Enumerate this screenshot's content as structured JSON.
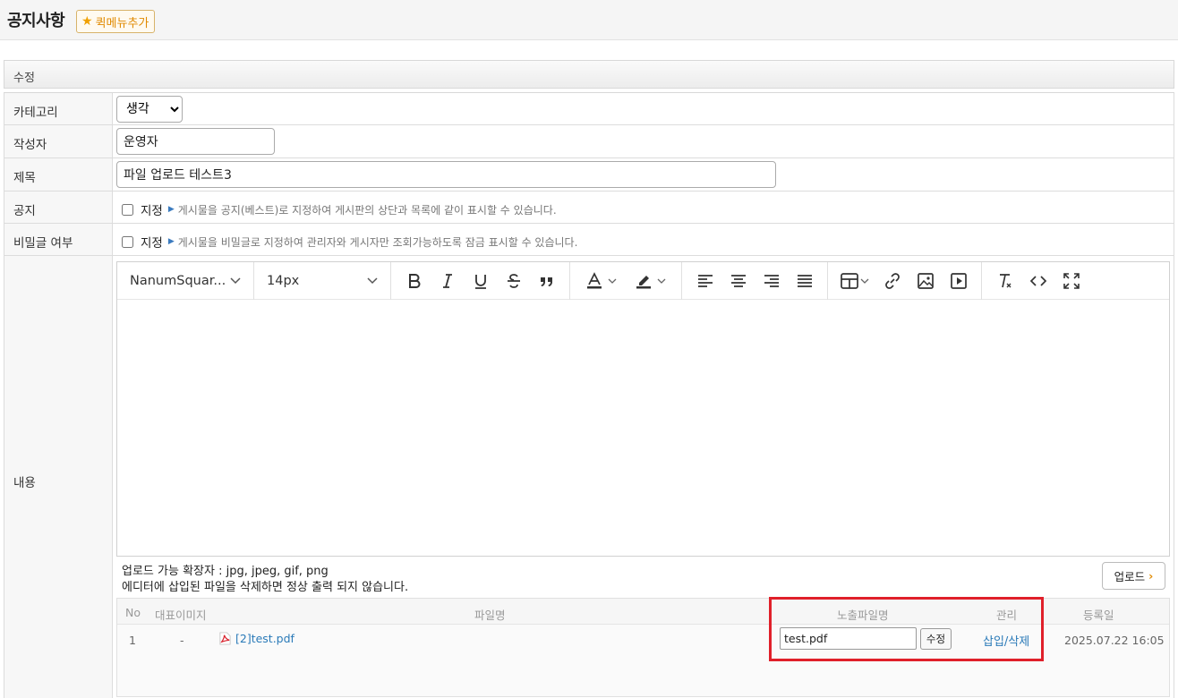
{
  "header": {
    "title": "공지사항",
    "quick_menu_label": "퀵메뉴추가"
  },
  "section": {
    "title": "수정"
  },
  "form": {
    "category": {
      "label": "카테고리",
      "selected": "생각"
    },
    "author": {
      "label": "작성자",
      "value": "운영자"
    },
    "subject": {
      "label": "제목",
      "value": "파일 업로드 테스트3"
    },
    "notice": {
      "label": "공지",
      "checkbox_label": "지정",
      "hint": "게시물을 공지(베스트)로 지정하여 게시판의 상단과 목록에 같이 표시할 수 있습니다."
    },
    "secret": {
      "label": "비밀글 여부",
      "checkbox_label": "지정",
      "hint": "게시물을 비밀글로 지정하여 관리자와 게시자만 조회가능하도록 잠금 표시할 수 있습니다."
    },
    "content": {
      "label": "내용"
    }
  },
  "editor": {
    "font_family": "NanumSquar...",
    "font_size": "14px",
    "tools": [
      "bold-icon",
      "italic-icon",
      "underline-icon",
      "strikethrough-icon",
      "quote-icon",
      "font-color-icon",
      "highlight-icon",
      "align-left-icon",
      "align-center-icon",
      "align-right-icon",
      "align-justify-icon",
      "table-icon",
      "link-icon",
      "image-icon",
      "video-icon",
      "clear-format-icon",
      "code-view-icon",
      "fullscreen-icon"
    ]
  },
  "upload": {
    "line1": "업로드 가능 확장자 : jpg, jpeg, gif, png",
    "line2": "에디터에 삽입된 파일을 삭제하면 정상 출력 되지 않습니다.",
    "button_label": "업로드"
  },
  "file_table": {
    "headers": {
      "no": "No",
      "thumb": "대표이미지",
      "filename": "파일명",
      "display_name": "노출파일명",
      "manage": "관리",
      "date": "등록일"
    },
    "rows": [
      {
        "no": "1",
        "thumb": "-",
        "filename": "[2]test.pdf",
        "display_name": "test.pdf",
        "edit_label": "수정",
        "insert_label": "삽입",
        "separator": "/",
        "delete_label": "삭제",
        "date": "2025.07.22 16:05"
      }
    ]
  },
  "colors": {
    "highlight": "#e0202a",
    "link": "#2a7ab8",
    "accent": "#e08a00"
  }
}
